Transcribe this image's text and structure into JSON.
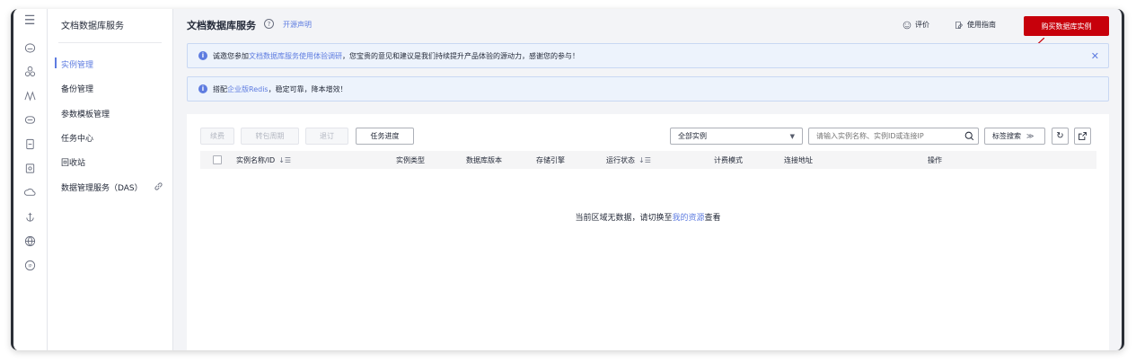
{
  "rail": {
    "icons": [
      "menu-icon",
      "cloud-icon",
      "cluster-icon",
      "wave-icon",
      "database-icon",
      "storage-icon",
      "security-icon",
      "cloud-outline-icon",
      "anchor-icon",
      "globe-icon",
      "ip-icon"
    ]
  },
  "nav": {
    "title": "文档数据库服务",
    "items": [
      {
        "label": "实例管理",
        "active": true
      },
      {
        "label": "备份管理"
      },
      {
        "label": "参数模板管理"
      },
      {
        "label": "任务中心"
      },
      {
        "label": "回收站"
      },
      {
        "label": "数据管理服务（DAS）"
      }
    ]
  },
  "header": {
    "title": "文档数据库服务",
    "open_source": "开源声明",
    "rate": "评价",
    "guide": "使用指南",
    "buy": "购买数据库实例"
  },
  "banners": {
    "survey_prefix": "诚邀您参加",
    "survey_link": "文档数据库服务使用体验调研",
    "survey_suffix": "，您宝贵的意见和建议是我们持续提升产品体验的源动力，感谢您的参与！",
    "redis_prefix": "搭配",
    "redis_link": "企业版Redis",
    "redis_suffix": "，稳定可靠，降本增效！"
  },
  "toolbar": {
    "renew": "续费",
    "to_package": "转包周期",
    "unsubscribe": "退订",
    "task_progress": "任务进度",
    "filter_value": "全部实例",
    "search_placeholder": "请输入实例名称、实例ID或连接IP",
    "tag_search": "标签搜索"
  },
  "table": {
    "columns": [
      "实例名称/ID",
      "实例类型",
      "数据库版本",
      "存储引擎",
      "运行状态",
      "计费模式",
      "连接地址",
      "操作"
    ],
    "empty_prefix": "当前区域无数据，请切换至",
    "empty_link": "我的资源",
    "empty_suffix": "查看"
  },
  "colors": {
    "accent": "#5e7ce0",
    "brand": "#c7000b"
  }
}
